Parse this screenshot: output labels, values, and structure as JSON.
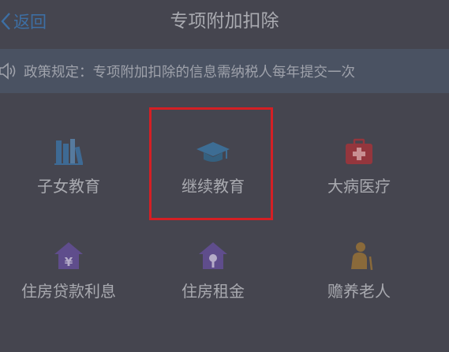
{
  "header": {
    "back_label": "返回",
    "title": "专项附加扣除"
  },
  "notice": {
    "icon": "speaker-icon",
    "text": "政策规定：专项附加扣除的信息需纳税人每年提交一次"
  },
  "items": [
    {
      "label": "子女教育",
      "icon": "books-icon",
      "color": "#3e6a94"
    },
    {
      "label": "继续教育",
      "icon": "graduation-cap-icon",
      "color": "#3d6d94"
    },
    {
      "label": "大病医疗",
      "icon": "medical-kit-icon",
      "color": "#94363d"
    },
    {
      "label": "住房贷款利息",
      "icon": "house-yuan-icon",
      "color": "#5f4d8c"
    },
    {
      "label": "住房租金",
      "icon": "house-key-icon",
      "color": "#5f4d8c"
    },
    {
      "label": "赡养老人",
      "icon": "elder-icon",
      "color": "#8a6a3a"
    }
  ],
  "highlight": {
    "target": "继续教育",
    "color": "#d41f24"
  }
}
